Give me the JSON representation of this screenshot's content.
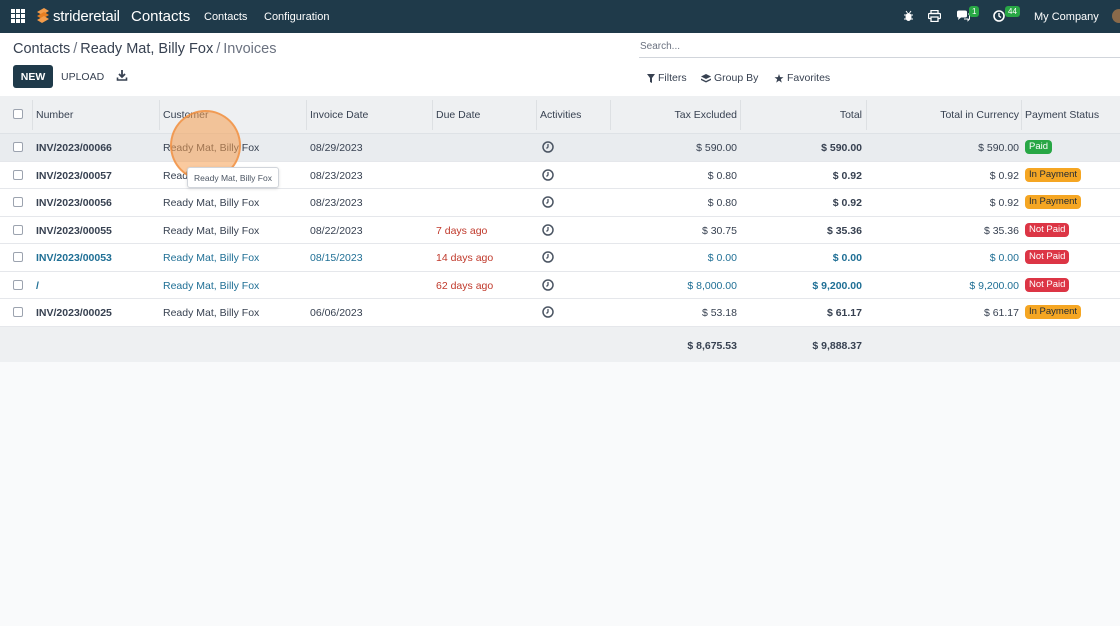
{
  "navbar": {
    "brand_a": "stride",
    "brand_b": "retail",
    "app_title": "Contacts",
    "menu": [
      "Contacts",
      "Configuration"
    ],
    "messages_badge": "1",
    "activities_badge": "44",
    "company": "My Company"
  },
  "breadcrumb": {
    "level1": "Contacts",
    "level2": "Ready Mat, Billy Fox",
    "current": "Invoices"
  },
  "actions": {
    "new_label": "NEW",
    "upload_label": "UPLOAD"
  },
  "search": {
    "placeholder": "Search..."
  },
  "filters": {
    "filters_label": "Filters",
    "groupby_label": "Group By",
    "favorites_label": "Favorites"
  },
  "columns": {
    "number": "Number",
    "customer": "Customer",
    "invoice_date": "Invoice Date",
    "due_date": "Due Date",
    "activities": "Activities",
    "tax_excluded": "Tax Excluded",
    "total": "Total",
    "total_currency": "Total in Currency",
    "payment_status": "Payment Status"
  },
  "rows": [
    {
      "number": "INV/2023/00066",
      "customer": "Ready Mat, Billy Fox",
      "invoice_date": "08/29/2023",
      "due_date": "",
      "tax_excluded": "$ 590.00",
      "total": "$ 590.00",
      "total_currency": "$ 590.00",
      "status": "Paid"
    },
    {
      "number": "INV/2023/00057",
      "customer": "Ready Mat, Billy Fox",
      "invoice_date": "08/23/2023",
      "due_date": "",
      "tax_excluded": "$ 0.80",
      "total": "$ 0.92",
      "total_currency": "$ 0.92",
      "status": "In Payment"
    },
    {
      "number": "INV/2023/00056",
      "customer": "Ready Mat, Billy Fox",
      "invoice_date": "08/23/2023",
      "due_date": "",
      "tax_excluded": "$ 0.80",
      "total": "$ 0.92",
      "total_currency": "$ 0.92",
      "status": "In Payment"
    },
    {
      "number": "INV/2023/00055",
      "customer": "Ready Mat, Billy Fox",
      "invoice_date": "08/22/2023",
      "due_date": "7 days ago",
      "tax_excluded": "$ 30.75",
      "total": "$ 35.36",
      "total_currency": "$ 35.36",
      "status": "Not Paid"
    },
    {
      "number": "INV/2023/00053",
      "customer": "Ready Mat, Billy Fox",
      "invoice_date": "08/15/2023",
      "due_date": "14 days ago",
      "tax_excluded": "$ 0.00",
      "total": "$ 0.00",
      "total_currency": "$ 0.00",
      "status": "Not Paid"
    },
    {
      "number": "/",
      "customer": "Ready Mat, Billy Fox",
      "invoice_date": "",
      "due_date": "62 days ago",
      "tax_excluded": "$ 8,000.00",
      "total": "$ 9,200.00",
      "total_currency": "$ 9,200.00",
      "status": "Not Paid"
    },
    {
      "number": "INV/2023/00025",
      "customer": "Ready Mat, Billy Fox",
      "invoice_date": "06/06/2023",
      "due_date": "",
      "tax_excluded": "$ 53.18",
      "total": "$ 61.17",
      "total_currency": "$ 61.17",
      "status": "In Payment"
    }
  ],
  "totals": {
    "tax_excluded": "$ 8,675.53",
    "total": "$ 9,888.37"
  },
  "tooltip": "Ready Mat, Billy Fox",
  "colors": {
    "navbar": "#1f3a4a",
    "paid": "#28a745",
    "in_payment": "#f5a623",
    "not_paid": "#dc3545",
    "link": "#1f6f95",
    "overdue": "#c0392b"
  }
}
